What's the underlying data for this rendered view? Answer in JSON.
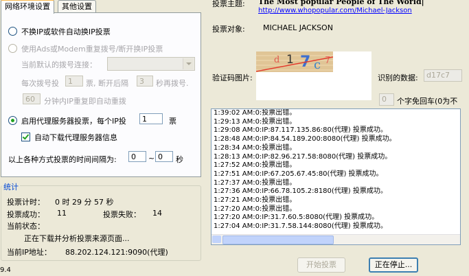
{
  "tabs": [
    {
      "label": "网络环境设置",
      "active": true
    },
    {
      "label": "其他设置",
      "active": false
    }
  ],
  "network": {
    "opt_no_change": "不换IP或软件自动换IP投票",
    "opt_adsl": "使用Ads或Modem重复拨号/断开换IP投票",
    "default_dial_label": "当前默认的拨号连接：",
    "default_dial_value": "",
    "dial_each_prefix": "每次拨号投",
    "dial_each_value": "1",
    "dial_each_mid": "票, 断开后隔",
    "dial_wait_value": "3",
    "dial_wait_suffix": "秒再拨号.",
    "repeat_value": "60",
    "repeat_suffix": "分钟内IP重复即自动重拨",
    "opt_proxy_prefix": "启用代理服务器投票，每个IP投",
    "proxy_votes_value": "1",
    "proxy_votes_suffix": "票",
    "auto_download_label": "自动下载代理服务器信息",
    "interval_label": "以上各种方式投票的时间间隔为:",
    "interval_min": "0",
    "interval_tilde": "~",
    "interval_max": "0",
    "interval_unit": "秒"
  },
  "stats": {
    "group_label": "统计",
    "timer_label": "投票计时：",
    "timer_value": "0 时 29 分 57 秒",
    "success_label": "投票成功：",
    "success_value": "11",
    "fail_label": "投票失败：",
    "fail_value": "14",
    "status_label": "当前状态：",
    "status_value": "正在下载并分析投票来源页面...",
    "ip_label": "当前IP地址：",
    "ip_value": "88.202.124.121:9090(代理)"
  },
  "version_fragment": "9.4",
  "vote": {
    "subject_label": "投票主题:",
    "subject_value": "The Most popular People of The World|",
    "subject_url": "http://www.whopopular.com/Michael-Jackson",
    "object_label": "投票对象:",
    "object_value": "MICHAEL JACKSON",
    "captcha_label": "验证码图片:",
    "captcha_text": "d17c7",
    "recognized_label": "识别的数据:",
    "recognized_value": "d17c7",
    "skip_value": "0",
    "skip_label": "个字免回车(0为不"
  },
  "log": [
    "1:39:02 AM:0:投票出错。",
    "1:29:13 AM:0:投票出错。",
    "1:29:08 AM:0:IP:87.117.135.86:80(代理) 投票成功。",
    "1:28:48 AM:0:IP:84.54.189.200:8080(代理) 投票成功。",
    "1:28:34 AM:0:投票出错。",
    "1:28:13 AM:0:IP:82.96.217.58:8080(代理) 投票成功。",
    "1:27:52 AM:0:投票出错。",
    "1:27:51 AM:0:IP:67.205.67.45:80(代理) 投票成功。",
    "1:27:37 AM:0:投票出错。",
    "1:27:36 AM:0:IP:66.78.105.2:8180(代理) 投票成功。",
    "1:27:21 AM:0:投票出错。",
    "1:27:20 AM:0:投票出错。",
    "1:27:20 AM:0:IP:31.7.60.5:8080(代理) 投票成功。",
    "1:27:04 AM:0:IP:31.7.58.144:8080(代理) 投票成功。"
  ],
  "buttons": {
    "start": "开始投票",
    "stopping": "正在停止..."
  }
}
